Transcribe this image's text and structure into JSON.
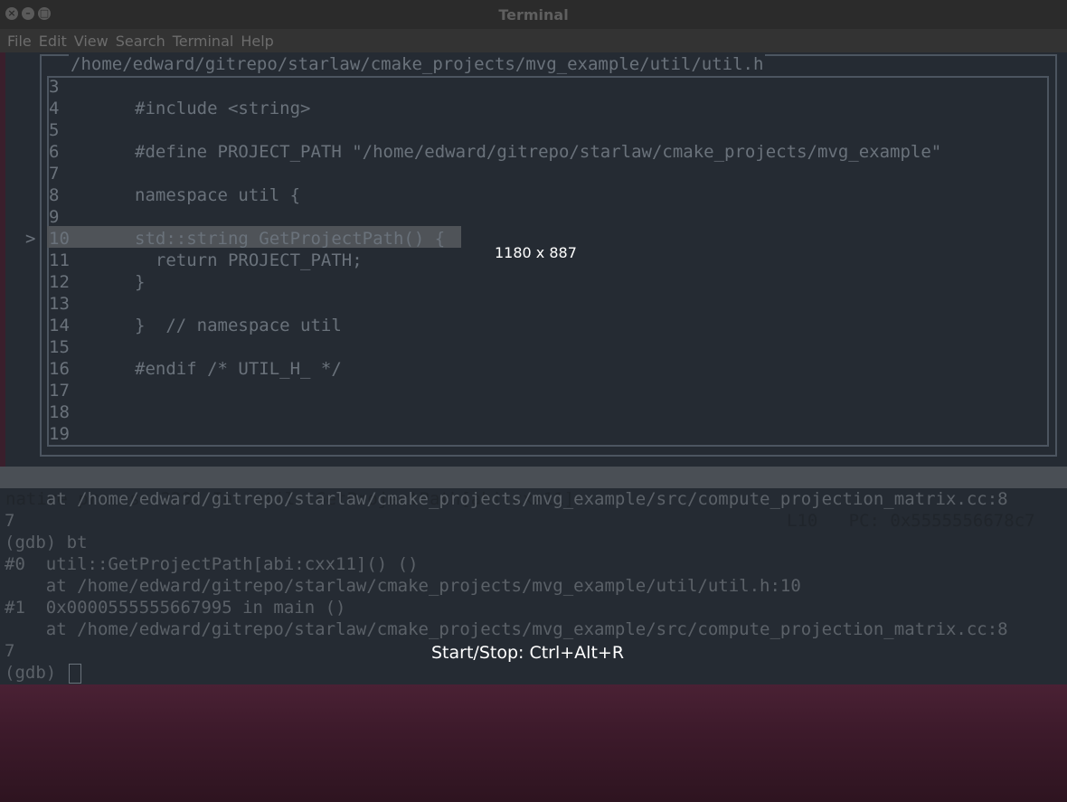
{
  "window": {
    "title": "Terminal",
    "controls": [
      "×",
      "–",
      "□"
    ]
  },
  "menu": [
    "File",
    "Edit",
    "View",
    "Search",
    "Terminal",
    "Help"
  ],
  "source": {
    "path": "/home/edward/gitrepo/starlaw/cmake_projects/mvg_example/util/util.h",
    "current_line": "10",
    "marker": ">",
    "lines": [
      {
        "n": "3",
        "code": ""
      },
      {
        "n": "4",
        "code": "#include <string>"
      },
      {
        "n": "5",
        "code": ""
      },
      {
        "n": "6",
        "code": "#define PROJECT_PATH \"/home/edward/gitrepo/starlaw/cmake_projects/mvg_example\""
      },
      {
        "n": "7",
        "code": ""
      },
      {
        "n": "8",
        "code": "namespace util {"
      },
      {
        "n": "9",
        "code": ""
      },
      {
        "n": "10",
        "code": "std::string GetProjectPath() {"
      },
      {
        "n": "11",
        "code": "  return PROJECT_PATH;"
      },
      {
        "n": "12",
        "code": "}"
      },
      {
        "n": "13",
        "code": ""
      },
      {
        "n": "14",
        "code": "}  // namespace util"
      },
      {
        "n": "15",
        "code": ""
      },
      {
        "n": "16",
        "code": "#endif /* UTIL_H_ */"
      },
      {
        "n": "17",
        "code": ""
      },
      {
        "n": "18",
        "code": ""
      },
      {
        "n": "19",
        "code": ""
      }
    ]
  },
  "status": {
    "left": "native process 2292 In: util::GetProjectPath[abi:cxx11]",
    "right": "L10   PC: 0x5555556678c7"
  },
  "gdb": [
    "    at /home/edward/gitrepo/starlaw/cmake_projects/mvg_example/src/compute_projection_matrix.cc:8",
    "7",
    "(gdb) bt",
    "#0  util::GetProjectPath[abi:cxx11]() ()",
    "    at /home/edward/gitrepo/starlaw/cmake_projects/mvg_example/util/util.h:10",
    "#1  0x0000555555667995 in main ()",
    "    at /home/edward/gitrepo/starlaw/cmake_projects/mvg_example/src/compute_projection_matrix.cc:8",
    "7",
    "(gdb) "
  ],
  "overlays": {
    "dimensions": "1180 x 887",
    "recorder": "Start/Stop: Ctrl+Alt+R"
  }
}
